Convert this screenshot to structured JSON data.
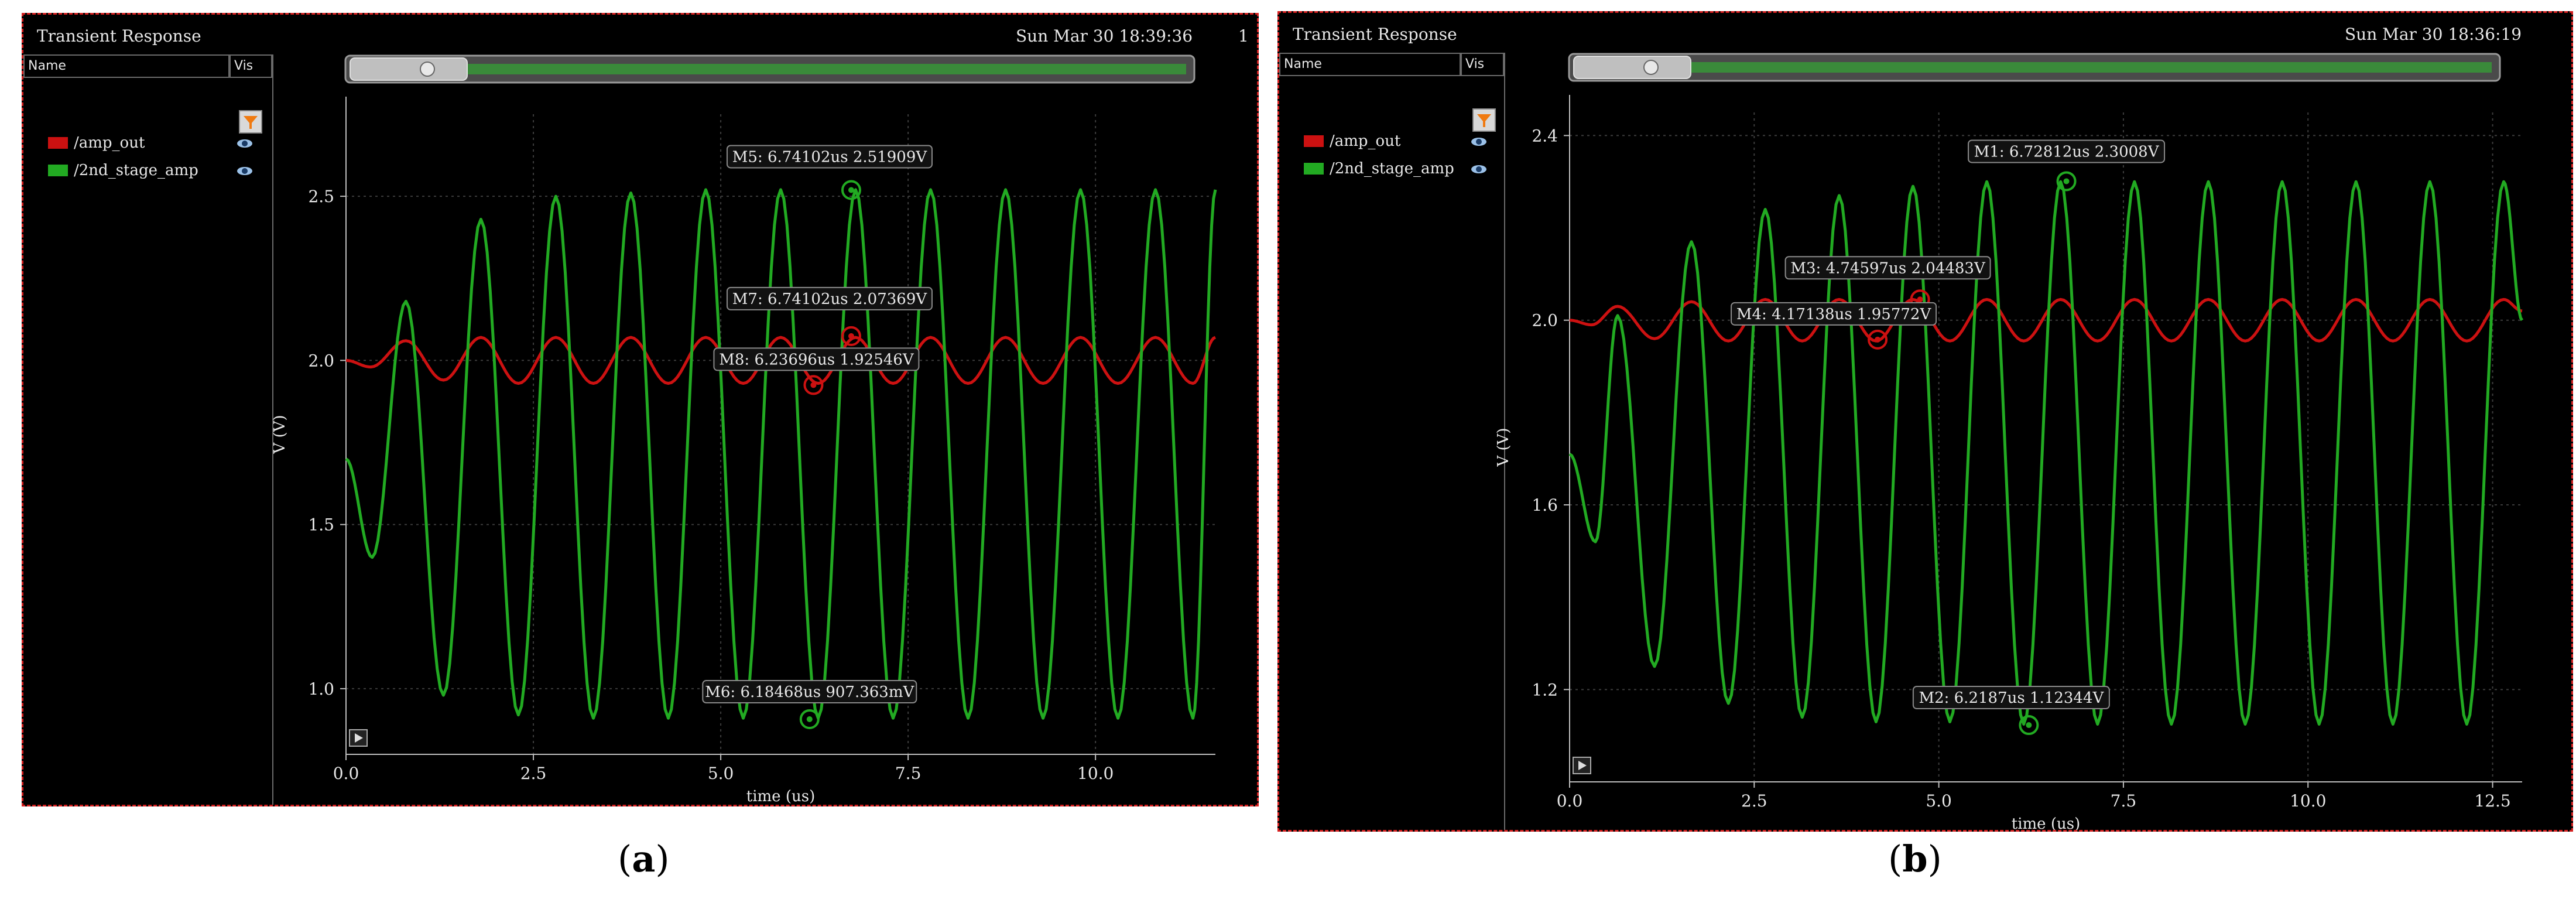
{
  "panels": [
    {
      "title": "Transient Response",
      "date": "Sun Mar 30 18:39:36",
      "date_extra": "1",
      "columns": {
        "name": "Name",
        "vis": "Vis"
      },
      "legend": [
        {
          "label": "/amp_out",
          "color": "#cc1111"
        },
        {
          "label": "/2nd_stage_amp",
          "color": "#22aa22"
        }
      ],
      "caption_letter": "a"
    },
    {
      "title": "Transient Response",
      "date": "Sun Mar 30 18:36:19",
      "date_extra": "",
      "columns": {
        "name": "Name",
        "vis": "Vis"
      },
      "legend": [
        {
          "label": "/amp_out",
          "color": "#cc1111"
        },
        {
          "label": "/2nd_stage_amp",
          "color": "#22aa22"
        }
      ],
      "caption_letter": "b"
    }
  ],
  "chart_data": [
    {
      "type": "line",
      "xlabel": "time (us)",
      "ylabel": "V (V)",
      "xlim": [
        0,
        11.6
      ],
      "ylim": [
        0.8,
        2.75
      ],
      "xticks": [
        "0.0",
        "2.5",
        "5.0",
        "7.5",
        "10.0"
      ],
      "xtick_values": [
        0,
        2.5,
        5,
        7.5,
        10
      ],
      "yticks": [
        "1.0",
        "1.5",
        "2.0",
        "2.5"
      ],
      "ytick_values": [
        1.0,
        1.5,
        2.0,
        2.5
      ],
      "grid": true,
      "series": [
        {
          "name": "/amp_out",
          "color": "#cc1111",
          "x": [
            0,
            0.33,
            0.8,
            1.3,
            1.8,
            2.3,
            2.8,
            3.3,
            3.8,
            4.3,
            4.8,
            5.3,
            5.8,
            6.3,
            6.8,
            7.3,
            7.8,
            8.3,
            8.8,
            9.3,
            9.8,
            10.3,
            10.8,
            11.3,
            11.6
          ],
          "y": [
            2.0,
            1.98,
            2.06,
            1.94,
            2.07,
            1.93,
            2.07,
            1.93,
            2.07,
            1.93,
            2.07,
            1.93,
            2.07,
            1.93,
            2.07,
            1.93,
            2.07,
            1.93,
            2.07,
            1.93,
            2.07,
            1.93,
            2.07,
            1.93,
            2.07
          ]
        },
        {
          "name": "/2nd_stage_amp",
          "color": "#22aa22",
          "x": [
            0,
            0.35,
            0.8,
            1.3,
            1.8,
            2.3,
            2.8,
            3.3,
            3.8,
            4.3,
            4.8,
            5.3,
            5.8,
            6.3,
            6.8,
            7.3,
            7.8,
            8.3,
            8.8,
            9.3,
            9.8,
            10.3,
            10.8,
            11.3,
            11.6
          ],
          "y": [
            1.7,
            1.4,
            2.18,
            0.98,
            2.43,
            0.92,
            2.5,
            0.91,
            2.51,
            0.91,
            2.52,
            0.91,
            2.52,
            0.91,
            2.52,
            0.91,
            2.52,
            0.91,
            2.52,
            0.91,
            2.52,
            0.91,
            2.52,
            0.91,
            2.52
          ]
        }
      ],
      "markers": [
        {
          "label": "M5: 6.74102us 2.51909V",
          "x": 6.741,
          "y": 2.519,
          "color": "#22aa22"
        },
        {
          "label": "M7: 6.74102us 2.07369V",
          "x": 6.741,
          "y": 2.074,
          "color": "#cc1111"
        },
        {
          "label": "M8: 6.23696us 1.92546V",
          "x": 6.237,
          "y": 1.925,
          "color": "#cc1111"
        },
        {
          "label": "M6: 6.18468us 907.363mV",
          "x": 6.185,
          "y": 0.907,
          "color": "#22aa22"
        }
      ]
    },
    {
      "type": "line",
      "xlabel": "time (us)",
      "ylabel": "V (V)",
      "xlim": [
        0,
        12.9
      ],
      "ylim": [
        1.0,
        2.45
      ],
      "xticks": [
        "0.0",
        "2.5",
        "5.0",
        "7.5",
        "10.0",
        "12.5"
      ],
      "xtick_values": [
        0,
        2.5,
        5,
        7.5,
        10,
        12.5
      ],
      "yticks": [
        "1.2",
        "1.6",
        "2.0",
        "2.4"
      ],
      "ytick_values": [
        1.2,
        1.6,
        2.0,
        2.4
      ],
      "grid": true,
      "series": [
        {
          "name": "/amp_out",
          "color": "#cc1111",
          "x": [
            0,
            0.3,
            0.65,
            1.15,
            1.65,
            2.15,
            2.65,
            3.15,
            3.65,
            4.15,
            4.65,
            5.15,
            5.65,
            6.15,
            6.65,
            7.15,
            7.65,
            8.15,
            8.65,
            9.15,
            9.65,
            10.15,
            10.65,
            11.15,
            11.65,
            12.15,
            12.65,
            12.9
          ],
          "y": [
            2.0,
            1.99,
            2.03,
            1.96,
            2.04,
            1.955,
            2.045,
            1.955,
            2.045,
            1.955,
            2.045,
            1.955,
            2.045,
            1.955,
            2.045,
            1.955,
            2.045,
            1.955,
            2.045,
            1.955,
            2.045,
            1.955,
            2.045,
            1.955,
            2.045,
            1.955,
            2.045,
            2.02
          ]
        },
        {
          "name": "/2nd_stage_amp",
          "color": "#22aa22",
          "x": [
            0,
            0.35,
            0.65,
            1.15,
            1.65,
            2.15,
            2.65,
            3.15,
            3.65,
            4.15,
            4.65,
            5.15,
            5.65,
            6.15,
            6.65,
            7.15,
            7.65,
            8.15,
            8.65,
            9.15,
            9.65,
            10.15,
            10.65,
            11.15,
            11.65,
            12.15,
            12.65,
            12.9
          ],
          "y": [
            1.71,
            1.52,
            2.01,
            1.25,
            2.17,
            1.17,
            2.24,
            1.14,
            2.27,
            1.13,
            2.29,
            1.13,
            2.3,
            1.125,
            2.3,
            1.125,
            2.3,
            1.125,
            2.3,
            1.125,
            2.3,
            1.125,
            2.3,
            1.125,
            2.3,
            1.125,
            2.3,
            2.0
          ]
        }
      ],
      "markers": [
        {
          "label": "M1: 6.72812us 2.3008V",
          "x": 6.728,
          "y": 2.301,
          "color": "#22aa22"
        },
        {
          "label": "M3: 4.74597us 2.04483V",
          "x": 4.746,
          "y": 2.045,
          "color": "#cc1111"
        },
        {
          "label": "M4: 4.17138us 1.95772V",
          "x": 4.171,
          "y": 1.958,
          "color": "#cc1111"
        },
        {
          "label": "M2: 6.2187us 1.12344V",
          "x": 6.219,
          "y": 1.123,
          "color": "#22aa22"
        }
      ]
    }
  ]
}
